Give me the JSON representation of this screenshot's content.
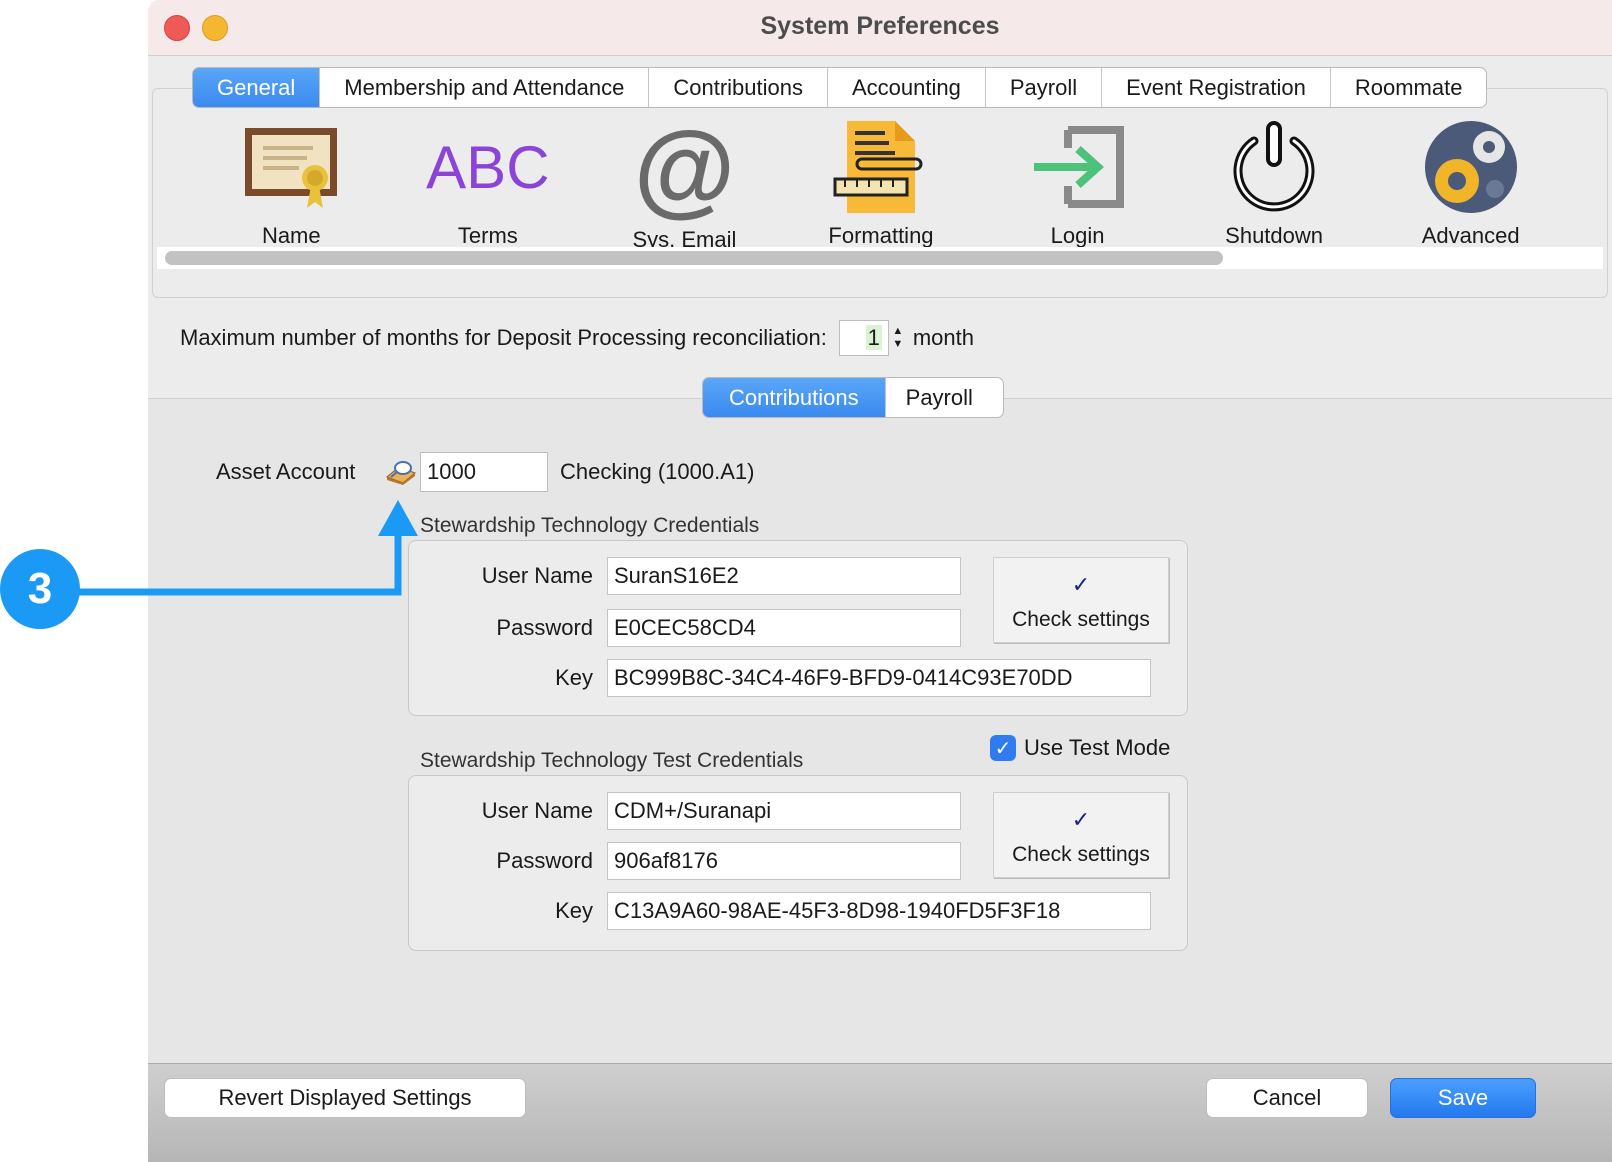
{
  "window": {
    "title": "System Preferences"
  },
  "tabs": [
    {
      "label": "General",
      "active": true
    },
    {
      "label": "Membership and Attendance",
      "active": false
    },
    {
      "label": "Contributions",
      "active": false
    },
    {
      "label": "Accounting",
      "active": false
    },
    {
      "label": "Payroll",
      "active": false
    },
    {
      "label": "Event Registration",
      "active": false
    },
    {
      "label": "Roommate",
      "active": false
    }
  ],
  "icons": [
    {
      "label": "Name",
      "icon": "certificate-icon"
    },
    {
      "label": "Terms",
      "icon": "abc-icon",
      "glyph": "ABC"
    },
    {
      "label": "Sys. Email",
      "icon": "at-sign-icon",
      "glyph": "@"
    },
    {
      "label": "Formatting",
      "icon": "formatting-icon"
    },
    {
      "label": "Login",
      "icon": "login-icon"
    },
    {
      "label": "Shutdown",
      "icon": "power-icon"
    },
    {
      "label": "Advanced",
      "icon": "gears-icon"
    }
  ],
  "deposit": {
    "label": "Maximum number of months for Deposit Processing reconciliation:",
    "value": "1",
    "unit": "month"
  },
  "subtabs": [
    {
      "label": "Contributions",
      "active": true
    },
    {
      "label": "Payroll",
      "active": false
    }
  ],
  "asset": {
    "label": "Asset Account",
    "value": "1000",
    "description": "Checking (1000.A1)"
  },
  "credentials": {
    "caption": "Stewardship Technology Credentials",
    "username_label": "User Name",
    "username": "SuranS16E2",
    "password_label": "Password",
    "password": "E0CEC58CD4",
    "key_label": "Key",
    "key": "BC999B8C-34C4-46F9-BFD9-0414C93E70DD",
    "check_label": "Check settings"
  },
  "test_credentials": {
    "caption": "Stewardship Technology Test Credentials",
    "test_mode_label": "Use Test Mode",
    "test_mode_checked": true,
    "username_label": "User Name",
    "username": "CDM+/Suranapi",
    "password_label": "Password",
    "password": "906af8176",
    "key_label": "Key",
    "key": "C13A9A60-98AE-45F3-8D98-1940FD5F3F18",
    "check_label": "Check settings"
  },
  "buttons": {
    "revert": "Revert Displayed Settings",
    "cancel": "Cancel",
    "save": "Save"
  },
  "annotation": {
    "step": "3"
  },
  "colors": {
    "accent": "#3a8af0",
    "annotation": "#1b9af5"
  }
}
